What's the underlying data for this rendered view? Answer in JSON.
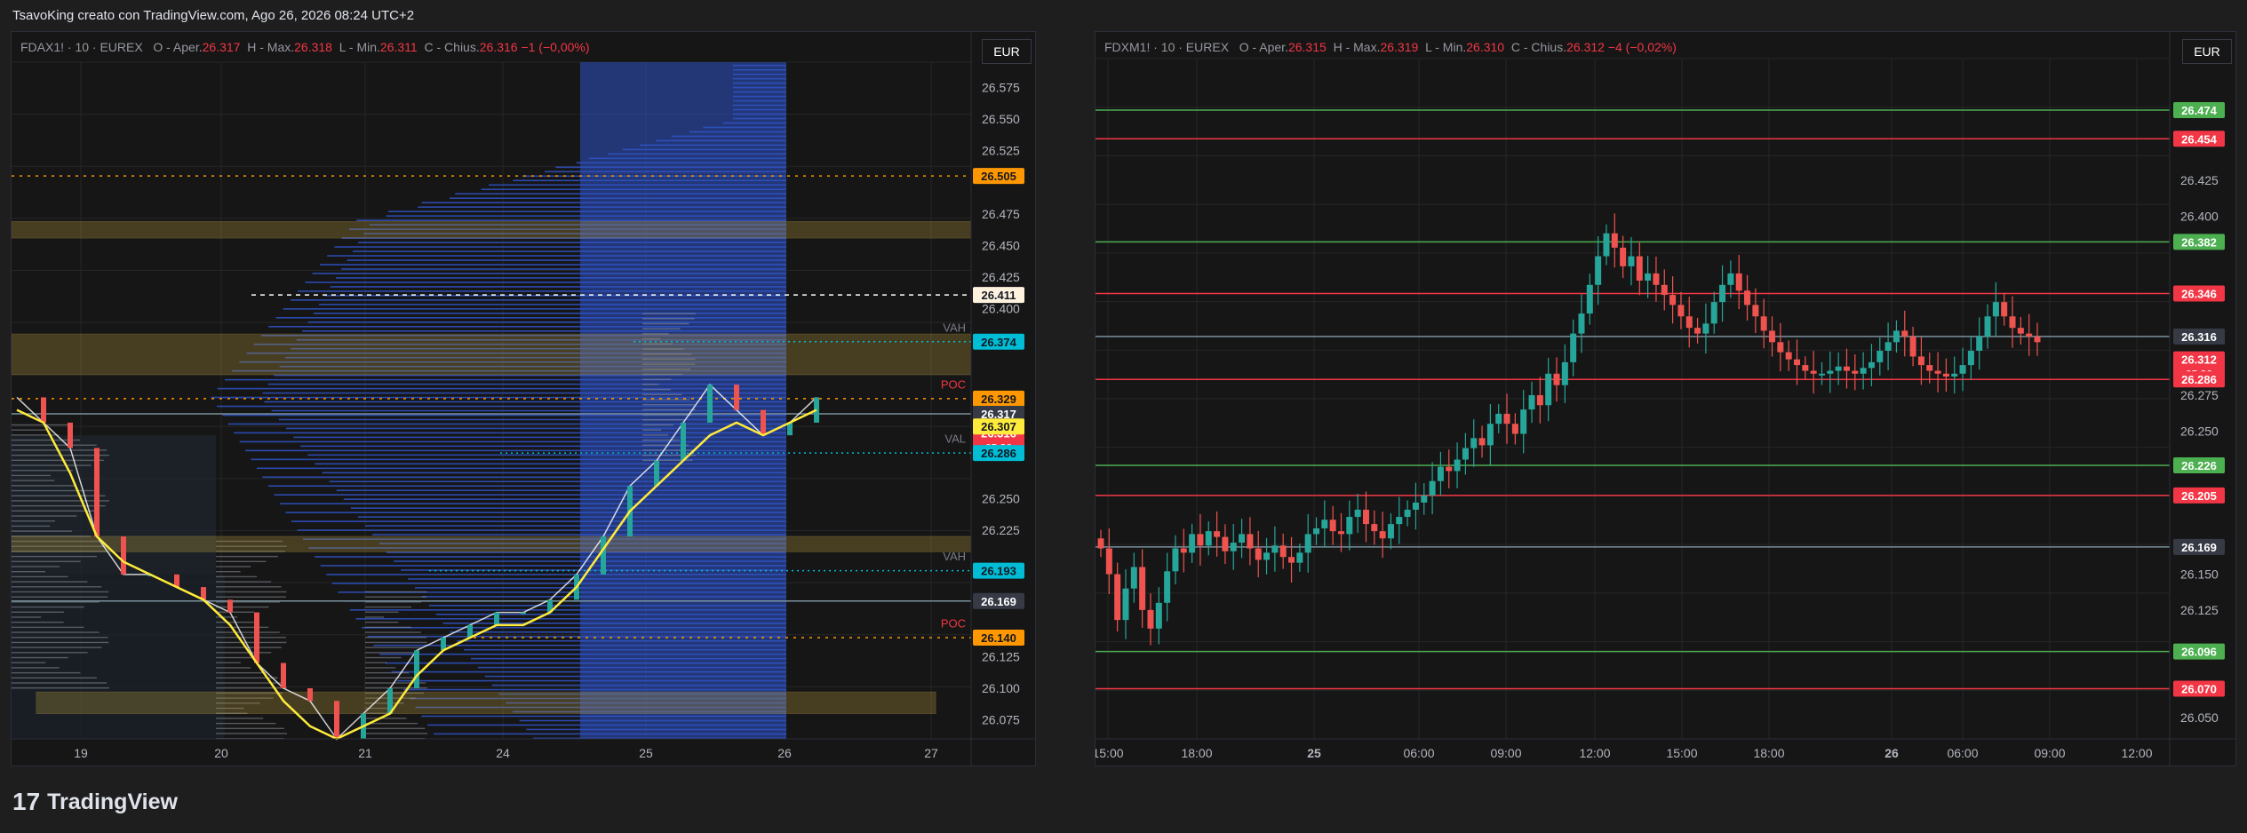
{
  "header": {
    "caption": "TsavoKing creato con TradingView.com, Ago 26, 2026 08:24 UTC+2"
  },
  "footer": {
    "brand": "TradingView",
    "logo": "17"
  },
  "colors": {
    "bg": "#161616",
    "grid": "#262626",
    "text": "#b2b5be",
    "up": "#26a69a",
    "down": "#ef5350",
    "green_line": "#4caf50",
    "red_line": "#f23645",
    "orange": "#ff9800",
    "cyan": "#00bcd4",
    "yellow": "#ffeb3b",
    "profile": "#2f54c9",
    "gray_line": "#78909c"
  },
  "chart_data": [
    {
      "type": "candlestick",
      "symbol": "FDAX1! · 10 · EUREX",
      "ohlc_labels": {
        "o": "O",
        "o_name": "- Aper.",
        "o_val": "26.317",
        "h": "H",
        "h_name": "- Max.",
        "h_val": "26.318",
        "l": "L",
        "l_name": "- Min.",
        "l_val": "26.311",
        "c": "C",
        "c_name": "- Chius.",
        "c_val": "26.316",
        "change": "−1 (−0,00%)"
      },
      "currency": "EUR",
      "ylim": [
        26.06,
        26.595
      ],
      "y_ticks": [
        "26.575",
        "26.550",
        "26.525",
        "26.475",
        "26.450",
        "26.425",
        "26.400",
        "26.250",
        "26.225",
        "26.125",
        "26.100",
        "26.075"
      ],
      "x_ticks": [
        "19",
        "20",
        "21",
        "24",
        "25",
        "26",
        "27"
      ],
      "price_tags": [
        {
          "price": 26.505,
          "label": "26.505",
          "color": "#ff9800"
        },
        {
          "price": 26.411,
          "label": "26.411",
          "color": "#fff3e0"
        },
        {
          "price": 26.374,
          "label": "26.374",
          "color": "#00bcd4"
        },
        {
          "price": 26.329,
          "label": "26.329",
          "color": "#ff9800"
        },
        {
          "price": 26.317,
          "label": "26.317",
          "color": "#363a45"
        },
        {
          "price": 26.302,
          "label": "26.316",
          "sub": "05:30",
          "color": "#f23645"
        },
        {
          "price": 26.307,
          "label": "26.307",
          "color": "#ffeb3b"
        },
        {
          "price": 26.286,
          "label": "26.286",
          "color": "#00bcd4"
        },
        {
          "price": 26.193,
          "label": "26.193",
          "color": "#00bcd4"
        },
        {
          "price": 26.169,
          "label": "26.169",
          "color": "#363a45"
        },
        {
          "price": 26.14,
          "label": "26.140",
          "color": "#ff9800"
        }
      ],
      "annotations": [
        {
          "text": "VAH",
          "price": 26.382,
          "color": "#787b86"
        },
        {
          "text": "POC",
          "price": 26.337,
          "color": "#f23645"
        },
        {
          "text": "VAL",
          "price": 26.294,
          "color": "#787b86"
        },
        {
          "text": "VAH",
          "price": 26.201,
          "color": "#787b86"
        },
        {
          "text": "POC",
          "price": 26.148,
          "color": "#f23645"
        }
      ],
      "zones": [
        [
          26.456,
          26.469
        ],
        [
          26.348,
          26.38
        ],
        [
          26.208,
          26.22
        ],
        [
          26.08,
          26.097
        ]
      ]
    },
    {
      "type": "candlestick",
      "symbol": "FDXM1! · 10 · EUREX",
      "ohlc_labels": {
        "o": "O",
        "o_name": "- Aper.",
        "o_val": "26.315",
        "h": "H",
        "h_name": "- Max.",
        "h_val": "26.319",
        "l": "L",
        "l_name": "- Min.",
        "l_val": "26.310",
        "c": "C",
        "c_name": "- Chius.",
        "c_val": "26.312",
        "change": "−4 (−0,02%)"
      },
      "currency": "EUR",
      "ylim": [
        26.035,
        26.51
      ],
      "y_ticks": [
        "26.425",
        "26.400",
        "26.275",
        "26.250",
        "26.150",
        "26.125",
        "26.050"
      ],
      "x_ticks": [
        "15:00",
        "18:00",
        "25",
        "06:00",
        "09:00",
        "12:00",
        "15:00",
        "18:00",
        "26",
        "06:00",
        "09:00",
        "12:00"
      ],
      "price_tags": [
        {
          "price": 26.474,
          "label": "26.474",
          "color": "#4caf50"
        },
        {
          "price": 26.454,
          "label": "26.454",
          "color": "#f23645"
        },
        {
          "price": 26.382,
          "label": "26.382",
          "color": "#4caf50"
        },
        {
          "price": 26.346,
          "label": "26.346",
          "color": "#f23645"
        },
        {
          "price": 26.316,
          "label": "26.316",
          "color": "#363a45"
        },
        {
          "price": 26.3,
          "label": "26.312",
          "sub": "05:30",
          "color": "#f23645"
        },
        {
          "price": 26.286,
          "label": "26.286",
          "color": "#f23645"
        },
        {
          "price": 26.226,
          "label": "26.226",
          "color": "#4caf50"
        },
        {
          "price": 26.205,
          "label": "26.205",
          "color": "#f23645"
        },
        {
          "price": 26.169,
          "label": "26.169",
          "color": "#363a45"
        },
        {
          "price": 26.096,
          "label": "26.096",
          "color": "#4caf50"
        },
        {
          "price": 26.07,
          "label": "26.070",
          "color": "#f23645"
        }
      ],
      "closes": [
        26.168,
        26.15,
        26.118,
        26.14,
        26.155,
        26.125,
        26.112,
        26.13,
        26.152,
        26.168,
        26.165,
        26.178,
        26.17,
        26.18,
        26.176,
        26.166,
        26.172,
        26.178,
        26.168,
        26.16,
        26.165,
        26.17,
        26.162,
        26.158,
        26.165,
        26.178,
        26.182,
        26.188,
        26.18,
        26.178,
        26.19,
        26.195,
        26.185,
        26.18,
        26.175,
        26.185,
        26.19,
        26.195,
        26.2,
        26.205,
        26.215,
        26.225,
        26.222,
        26.23,
        26.238,
        26.245,
        26.24,
        26.255,
        26.262,
        26.255,
        26.248,
        26.265,
        26.275,
        26.268,
        26.29,
        26.282,
        26.298,
        26.318,
        26.332,
        26.352,
        26.372,
        26.388,
        26.378,
        26.365,
        26.372,
        26.355,
        26.36,
        26.352,
        26.345,
        26.338,
        26.33,
        26.322,
        26.318,
        26.325,
        26.34,
        26.352,
        26.36,
        26.348,
        26.338,
        26.33,
        26.32,
        26.312,
        26.305,
        26.3,
        26.296,
        26.292,
        26.29,
        26.29,
        26.292,
        26.295,
        26.292,
        26.29,
        26.294,
        26.298,
        26.306,
        26.312,
        26.32,
        26.316,
        26.302,
        26.296,
        26.292,
        26.29,
        26.288,
        26.29,
        26.296,
        26.306,
        26.316,
        26.33,
        26.34,
        26.33,
        26.322,
        26.318,
        26.316,
        26.312
      ]
    }
  ]
}
